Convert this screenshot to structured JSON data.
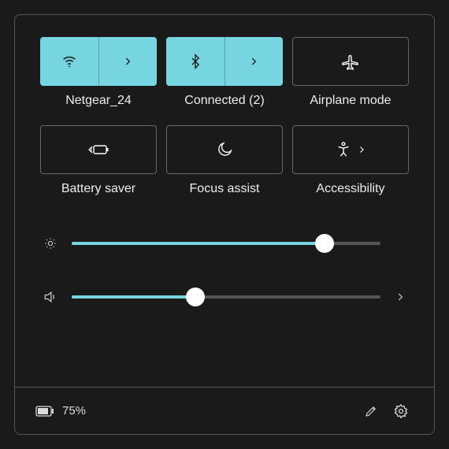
{
  "colors": {
    "accent": "#76d5e0"
  },
  "tiles": {
    "wifi": {
      "label": "Netgear_24",
      "active": true,
      "expandable": true
    },
    "bluetooth": {
      "label": "Connected (2)",
      "active": true,
      "expandable": true
    },
    "airplane": {
      "label": "Airplane mode",
      "active": false,
      "expandable": false
    },
    "battery": {
      "label": "Battery saver",
      "active": false,
      "expandable": false
    },
    "focus": {
      "label": "Focus assist",
      "active": false,
      "expandable": false
    },
    "access": {
      "label": "Accessibility",
      "active": false,
      "expandable": true
    }
  },
  "sliders": {
    "brightness": {
      "value": 82
    },
    "volume": {
      "value": 40
    }
  },
  "footer": {
    "battery_percent": "75%"
  }
}
